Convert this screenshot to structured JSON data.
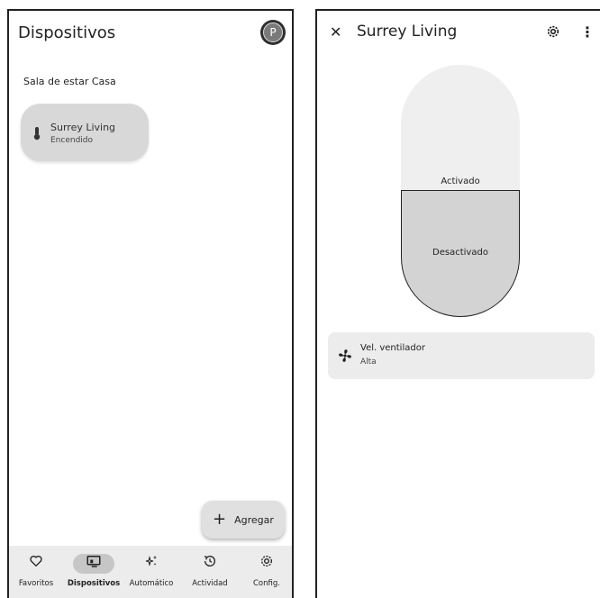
{
  "left": {
    "title": "Dispositivos",
    "avatar_letter": "P",
    "room_label": "Sala de estar Casa",
    "device": {
      "name": "Surrey Living",
      "status": "Encendido",
      "icon": "thermostat-icon"
    },
    "fab": {
      "label": "Agregar",
      "icon": "plus-icon"
    },
    "nav": [
      {
        "label": "Favoritos",
        "icon": "heart-icon",
        "active": false
      },
      {
        "label": "Dispositivos",
        "icon": "devices-icon",
        "active": true
      },
      {
        "label": "Automático",
        "icon": "sparkle-icon",
        "active": false
      },
      {
        "label": "Actividad",
        "icon": "history-icon",
        "active": false
      },
      {
        "label": "Config.",
        "icon": "gear-icon",
        "active": false
      }
    ]
  },
  "right": {
    "title": "Surrey Living",
    "close_icon": "close-icon",
    "settings_icon": "gear-icon",
    "more_icon": "more-vert-icon",
    "toggle": {
      "on_label": "Activado",
      "off_label": "Desactivado",
      "state": "off"
    },
    "fan": {
      "label": "Vel. ventilador",
      "value": "Alta",
      "icon": "fan-icon"
    }
  },
  "colors": {
    "card": "#d8d8d8",
    "nav_bg": "#ececec",
    "active_pill": "#c6c6c6",
    "text": "#1f1f1f"
  }
}
